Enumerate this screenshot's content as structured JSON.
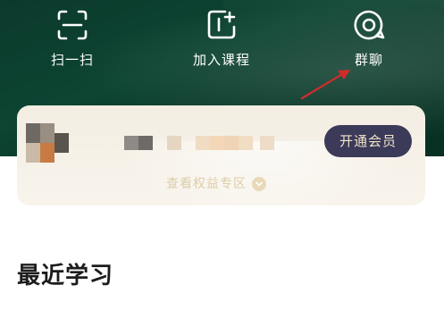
{
  "quick_actions": [
    {
      "label": "扫一扫",
      "icon": "scan-icon"
    },
    {
      "label": "加入课程",
      "icon": "add-course-icon"
    },
    {
      "label": "群聊",
      "icon": "chat-bubble-icon"
    }
  ],
  "member_card": {
    "join_button": "开通会员",
    "benefits_link": "查看权益专区"
  },
  "section": {
    "title": "最近学习"
  },
  "colors": {
    "header_green": "#0d4432",
    "button_bg": "#3b3a59",
    "button_text": "#f1e3c8",
    "annotation_arrow": "#d22b2b"
  }
}
